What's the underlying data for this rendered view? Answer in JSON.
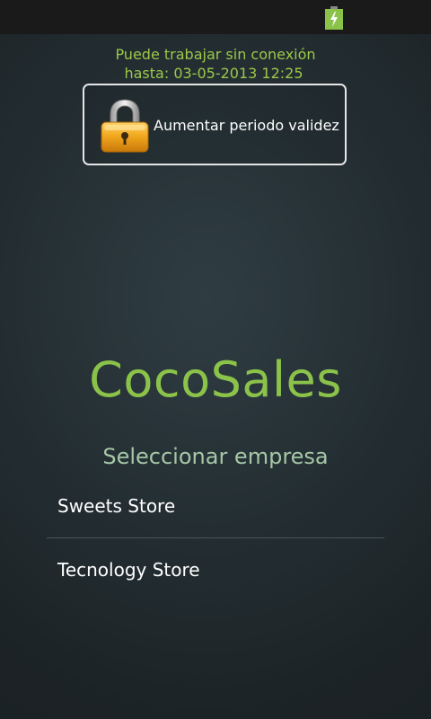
{
  "offline_notice": {
    "line1": "Puede trabajar sin conexión",
    "line2": "hasta:  03-05-2013 12:25"
  },
  "extend_button": {
    "label": "Aumentar periodo validez",
    "icon": "padlock-icon"
  },
  "app": {
    "title": "CocoSales"
  },
  "company_selection": {
    "heading": "Seleccionar empresa",
    "items": [
      {
        "label": "Sweets Store"
      },
      {
        "label": "Tecnology Store"
      }
    ]
  },
  "status_bar": {
    "battery_icon": "battery-charging-icon"
  },
  "colors": {
    "accent_green": "#8bc34a",
    "notice_green": "#9bc84a",
    "heading_green": "#a6c7a6"
  }
}
